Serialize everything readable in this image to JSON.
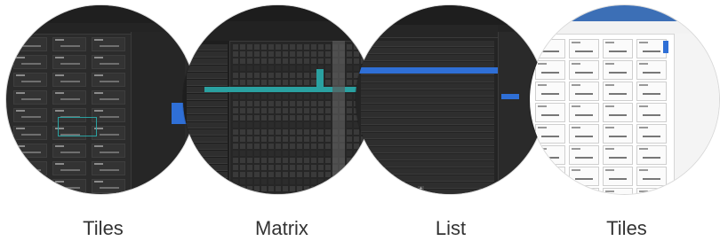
{
  "captions": {
    "tiles_dark": "Tiles",
    "matrix": "Matrix",
    "list": "List",
    "tiles_light": "Tiles"
  },
  "colors": {
    "dark_bg": "#2b2b2b",
    "panel": "#1c1c1c",
    "accent_blue": "#2f6fd6",
    "accent_teal": "#2aa1a1",
    "light_header_blue": "#3c6fb6",
    "light_bg": "#ffffff"
  },
  "icons": {
    "add": "plus-icon",
    "checkbox": "checkbox-icon"
  }
}
